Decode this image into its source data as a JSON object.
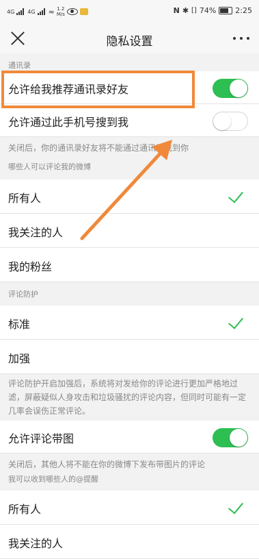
{
  "statusbar": {
    "signal1": "4G",
    "signal2": "4G",
    "speed_value": "1.2",
    "speed_unit": "M/s",
    "battery": "74%",
    "time": "2:25"
  },
  "nav": {
    "title": "隐私设置"
  },
  "sections": {
    "contacts": {
      "header": "通讯录",
      "recommend_label": "允许给我推荐通讯录好友",
      "recommend_on": true,
      "phone_search_label": "允许通过此手机号搜到我",
      "phone_search_on": false,
      "note": "关闭后，你的通讯录好友将不能通过通讯录找到你"
    },
    "comment_who": {
      "header": "哪些人可以评论我的微博",
      "options": [
        "所有人",
        "我关注的人",
        "我的粉丝"
      ],
      "selected": 0
    },
    "comment_protect": {
      "header": "评论防护",
      "options": [
        "标准",
        "加强"
      ],
      "selected": 0,
      "note": "评论防护开启加强后，系统将对发给你的评论进行更加严格地过滤，屏蔽疑似人身攻击和垃圾骚扰的评论内容，但同时可能有一定几率会误伤正常评论。",
      "image_comment_label": "允许评论带图",
      "image_comment_on": true,
      "image_comment_note": "关闭后，其他人将不能在你的微博下发布带图片的评论"
    },
    "mentions": {
      "header": "我可以收到哪些人的@提醒",
      "options": [
        "所有人",
        "我关注的人"
      ],
      "selected": 0
    }
  },
  "colors": {
    "accent_green": "#2dbf52",
    "highlight_orange": "#f0893a"
  }
}
